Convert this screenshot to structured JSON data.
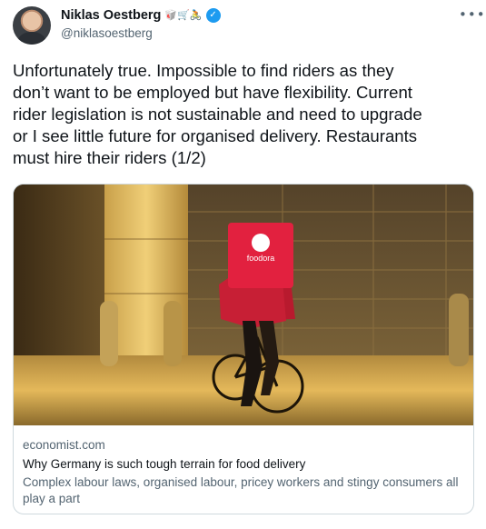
{
  "author": {
    "display_name": "Niklas Oestberg",
    "handle": "@niklasoestberg",
    "badges": "🥡🛒🚴"
  },
  "tweet": {
    "text": "Unfortunately true. Impossible to find riders as they\ndon’t want to be employed but have flexibility. Current\nrider legislation is not sustainable and need to upgrade\nor I see little future for organised delivery. Restaurants\nmust hire their riders (1/2)"
  },
  "card": {
    "bag_label": "foodora",
    "domain": "economist.com",
    "title": "Why Germany is such tough terrain for food delivery",
    "description": "Complex labour laws, organised labour, pricey workers and stingy consumers all play a part"
  },
  "icons": {
    "more": "more-horizontal-icon",
    "verified": "verified-badge-icon"
  },
  "colors": {
    "verified": "#1d9bf0",
    "secondary_text": "#536471",
    "bag": "#e2213f"
  }
}
